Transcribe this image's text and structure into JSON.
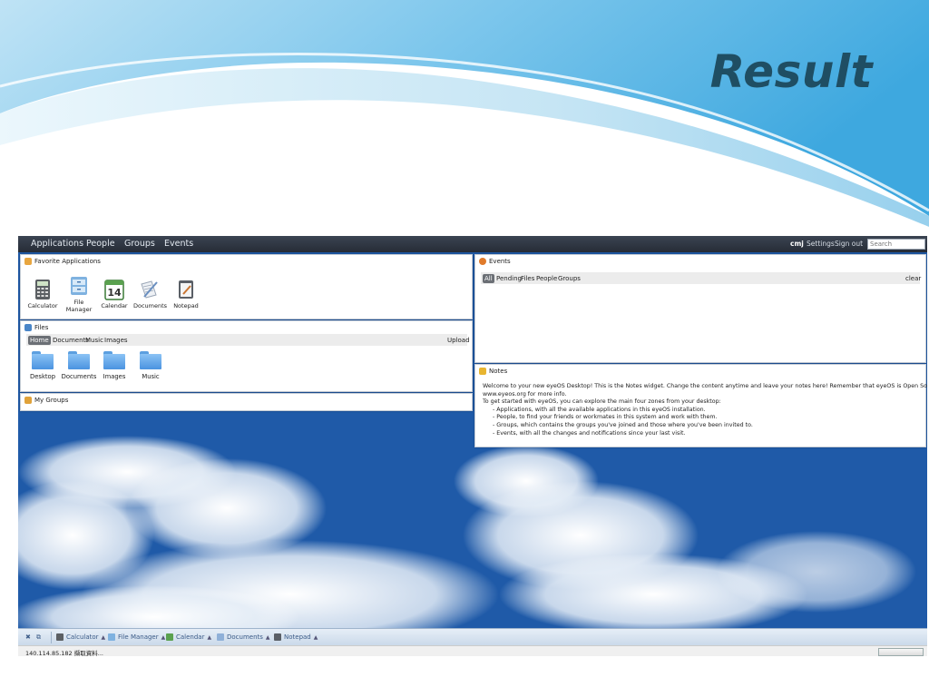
{
  "slide": {
    "title": "Result"
  },
  "topbar": {
    "menu": [
      "Applications",
      "People",
      "Groups",
      "Events"
    ],
    "user": "cmj",
    "settings": "Settings",
    "signout": "Sign out",
    "search_placeholder": "Search"
  },
  "favorites": {
    "title": "Favorite Applications",
    "apps": [
      {
        "label": "Calculator",
        "icon": "calculator-icon"
      },
      {
        "label": "File Manager",
        "icon": "file-manager-icon"
      },
      {
        "label": "Calendar",
        "icon": "calendar-icon",
        "day": "14"
      },
      {
        "label": "Documents",
        "icon": "documents-icon"
      },
      {
        "label": "Notepad",
        "icon": "notepad-icon"
      }
    ]
  },
  "files": {
    "title": "Files",
    "tabs": [
      "Home",
      "Documents",
      "Music",
      "Images"
    ],
    "upload": "Upload",
    "folders": [
      "Desktop",
      "Documents",
      "Images",
      "Music"
    ]
  },
  "groups": {
    "title": "My Groups"
  },
  "events": {
    "title": "Events",
    "filters": [
      "All",
      "Pending",
      "Files",
      "People",
      "Groups"
    ],
    "clear": "clear"
  },
  "notes": {
    "title": "Notes",
    "lines": [
      "Welcome to your new eyeOS Desktop! This is the Notes widget. Change the content anytime and leave your notes here! Remember that eyeOS is Open Source. Visit",
      "www.eyeos.org for more info.",
      "To get started with eyeOS, you can explore the main four zones from your desktop:",
      "- Applications, with all the available applications in this eyeOS installation.",
      "- People, to find your friends or workmates in this system and work with them.",
      "- Groups, which contains the groups you've joined and those where you've been invited to.",
      "- Events, with all the changes and notifications since your last visit."
    ]
  },
  "taskbar": {
    "items": [
      "Calculator",
      "File Manager",
      "Calendar",
      "Documents",
      "Notepad"
    ]
  },
  "statusbar": {
    "text": "140.114.85.182 擷取資料..."
  },
  "colors": {
    "topbar": "#2f3642",
    "title_text": "#1f4e63",
    "taskbar": "#d6e2f0"
  }
}
